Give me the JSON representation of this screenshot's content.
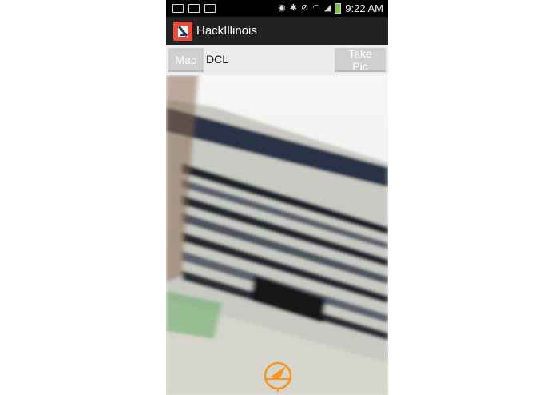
{
  "status_bar": {
    "time": "9:22 AM",
    "left_icons": [
      "image-icon",
      "gmail-icon",
      "gmail-icon"
    ],
    "right_icons": [
      "eye-icon",
      "bluetooth-icon",
      "mute-icon",
      "wifi-icon",
      "signal-icon",
      "battery-icon"
    ]
  },
  "action_bar": {
    "title": "HackIllinois",
    "icon": "app-logo-icon"
  },
  "toolbar": {
    "map_label": "Map",
    "location_text": "DCL",
    "take_pic_label": "Take Pic"
  },
  "camera": {
    "overlay_icon": "compass-icon",
    "accent_color": "#f7941d"
  },
  "colors": {
    "status_bar_bg": "#000000",
    "action_bar_bg": "#222222",
    "toolbar_bg": "#ececec",
    "button_bg": "#cfcfcf",
    "app_icon_bg": "#e64a3c"
  }
}
